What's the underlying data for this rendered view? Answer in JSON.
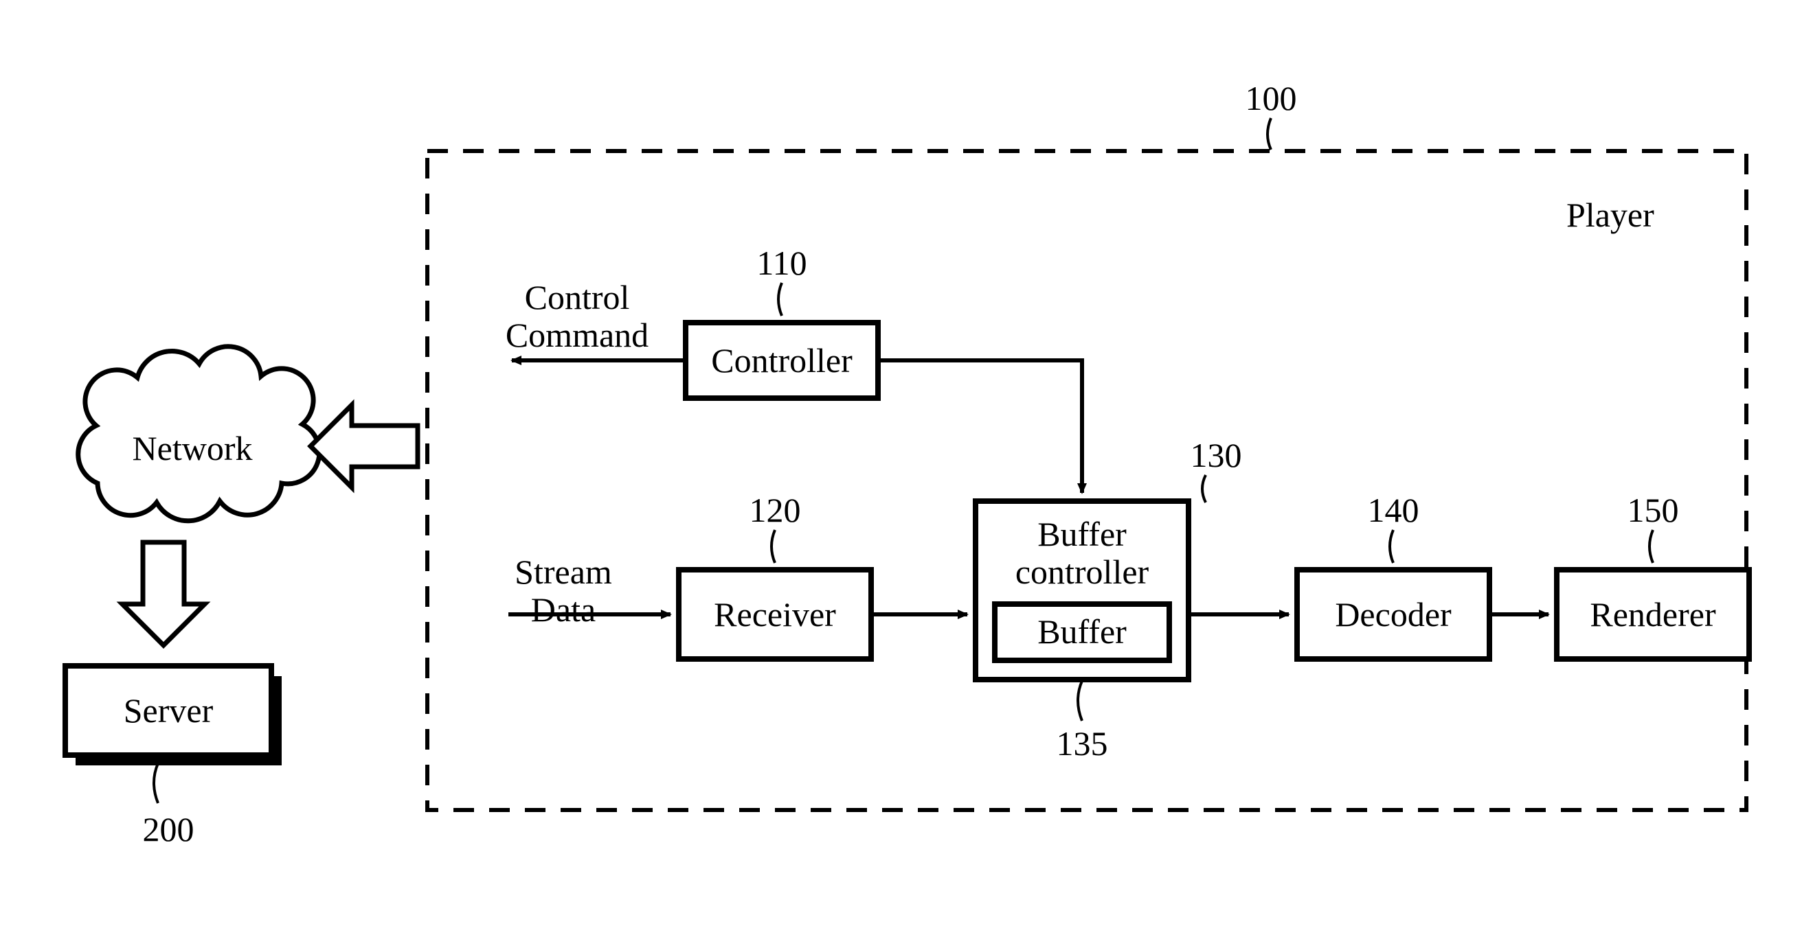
{
  "refs": {
    "player": "100",
    "controller": "110",
    "receiver": "120",
    "buffer_controller": "130",
    "buffer": "135",
    "decoder": "140",
    "renderer": "150",
    "server": "200"
  },
  "labels": {
    "player": "Player",
    "controller": "Controller",
    "receiver": "Receiver",
    "buffer_controller_l1": "Buffer",
    "buffer_controller_l2": "controller",
    "buffer": "Buffer",
    "decoder": "Decoder",
    "renderer": "Renderer",
    "network": "Network",
    "server": "Server",
    "control_command_l1": "Control",
    "control_command_l2": "Command",
    "stream_data_l1": "Stream",
    "stream_data_l2": "Data"
  }
}
